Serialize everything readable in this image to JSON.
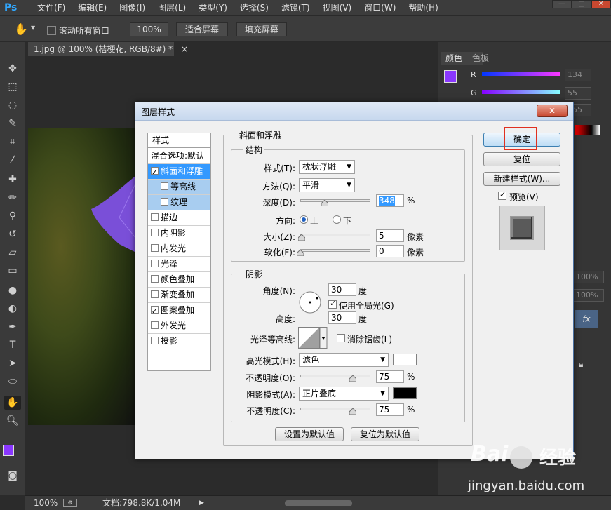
{
  "app": {
    "logo": "Ps",
    "menus": [
      "文件(F)",
      "编辑(E)",
      "图像(I)",
      "图层(L)",
      "类型(Y)",
      "选择(S)",
      "滤镜(T)",
      "视图(V)",
      "窗口(W)",
      "帮助(H)"
    ],
    "window_controls": [
      "—",
      "□",
      "✕"
    ]
  },
  "options_bar": {
    "scroll_all_label": "滚动所有窗口",
    "zoom_100_label": "100%",
    "fit_screen_label": "适合屏幕",
    "fill_screen_label": "填充屏幕"
  },
  "document": {
    "tab_title": "1.jpg @ 100% (桔梗花, RGB/8#) *",
    "tab_close": "×"
  },
  "right_panel": {
    "tabs": [
      "颜色",
      "色板"
    ],
    "r_label": "R",
    "g_label": "G",
    "r_value": "134",
    "g_value": "55",
    "b_value": "255",
    "opacity_a": "100%",
    "opacity_b": "100%",
    "fx_label": "fx"
  },
  "status": {
    "zoom": "100%",
    "doc_info": "文档:798.8K/1.04M"
  },
  "dialog": {
    "title": "图层样式",
    "close_label": "✕",
    "styles_header": "样式",
    "styles": [
      {
        "label": "混合选项:默认",
        "checkbox": false,
        "checked": false
      },
      {
        "label": "斜面和浮雕",
        "checkbox": true,
        "checked": true
      },
      {
        "label": "等高线",
        "checkbox": true,
        "checked": false
      },
      {
        "label": "纹理",
        "checkbox": true,
        "checked": false
      },
      {
        "label": "描边",
        "checkbox": true,
        "checked": false
      },
      {
        "label": "内阴影",
        "checkbox": true,
        "checked": false
      },
      {
        "label": "内发光",
        "checkbox": true,
        "checked": false
      },
      {
        "label": "光泽",
        "checkbox": true,
        "checked": false
      },
      {
        "label": "颜色叠加",
        "checkbox": true,
        "checked": false
      },
      {
        "label": "渐变叠加",
        "checkbox": true,
        "checked": false
      },
      {
        "label": "图案叠加",
        "checkbox": true,
        "checked": true
      },
      {
        "label": "外发光",
        "checkbox": true,
        "checked": false
      },
      {
        "label": "投影",
        "checkbox": true,
        "checked": false
      }
    ],
    "bevel_group_title": "斜面和浮雕",
    "structure": {
      "title": "结构",
      "style_label": "样式(T):",
      "style_value": "枕状浮雕",
      "technique_label": "方法(Q):",
      "technique_value": "平滑",
      "depth_label": "深度(D):",
      "depth_value": "348",
      "depth_level": 0.35,
      "percent": "%",
      "direction_label": "方向:",
      "direction_up": "上",
      "direction_down": "下",
      "size_label": "大小(Z):",
      "size_value": "5",
      "size_level": 0.02,
      "size_unit": "像素",
      "soften_label": "软化(F):",
      "soften_value": "0",
      "soften_level": 0,
      "soften_unit": "像素"
    },
    "shading": {
      "title": "阴影",
      "angle_label": "角度(N):",
      "angle_value": "30",
      "degree": "度",
      "use_global_light": "使用全局光(G)",
      "altitude_label": "高度:",
      "altitude_value": "30",
      "gloss_contour_label": "光泽等高线:",
      "anti_aliased": "消除锯齿(L)",
      "highlight_mode_label": "高光模式(H):",
      "highlight_mode_value": "滤色",
      "highlight_color": "#ffffff",
      "highlight_opacity_label": "不透明度(O):",
      "highlight_opacity_value": "75",
      "highlight_opacity_level": 0.75,
      "shadow_mode_label": "阴影模式(A):",
      "shadow_mode_value": "正片叠底",
      "shadow_color": "#000000",
      "shadow_opacity_label": "不透明度(C):",
      "shadow_opacity_value": "75",
      "shadow_opacity_level": 0.75,
      "percent": "%"
    },
    "set_default": "设置为默认值",
    "reset_default": "复位为默认值",
    "ok": "确定",
    "reset": "复位",
    "new_style": "新建样式(W)...",
    "preview": "预览(V)"
  },
  "watermark": {
    "brand_a": "Bai",
    "brand_b": "经验",
    "url": "jingyan.baidu.com"
  },
  "colors": {
    "foreground": "#8a37ff",
    "highlight_box": "#e03020",
    "selection": "#3399ff"
  }
}
